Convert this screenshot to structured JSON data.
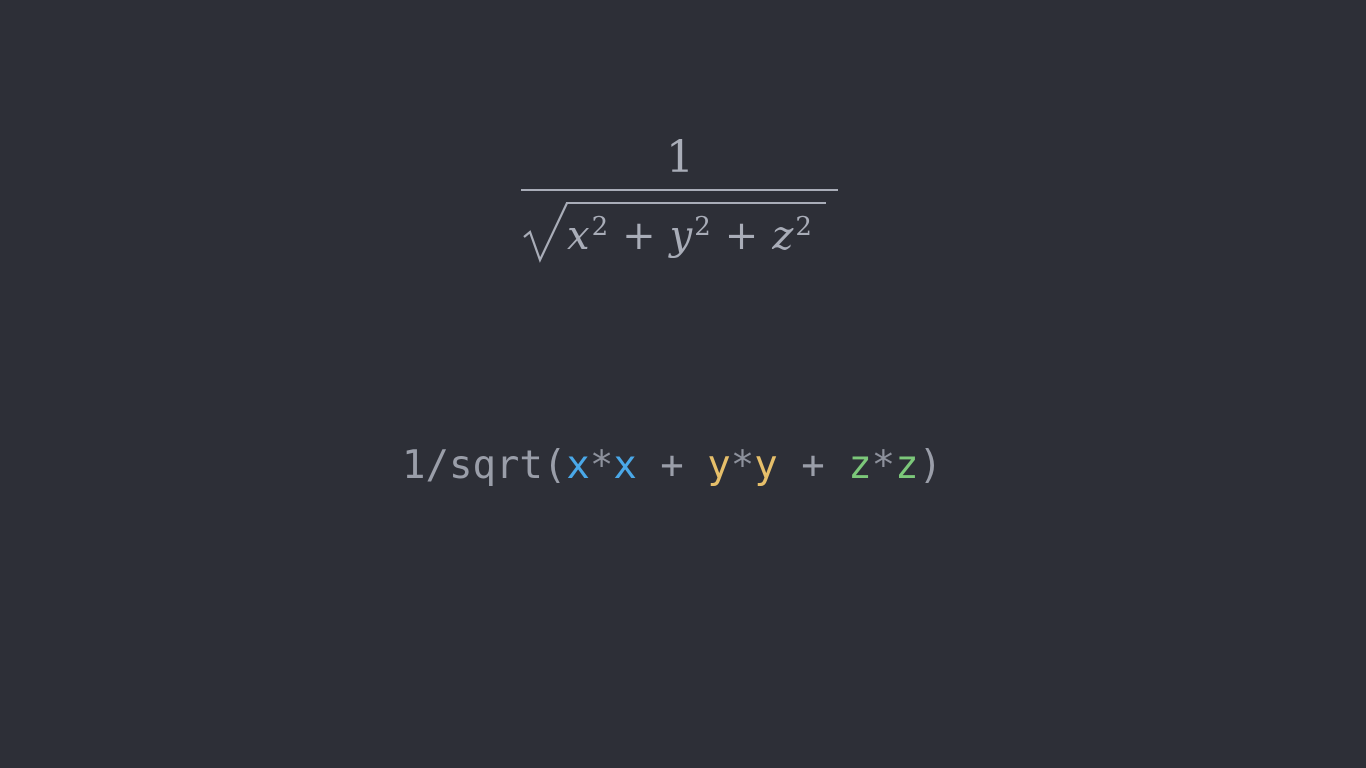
{
  "formula": {
    "numerator": "1",
    "radicand": [
      {
        "var": "x",
        "exp": "2"
      },
      {
        "op": "+"
      },
      {
        "var": "y",
        "exp": "2"
      },
      {
        "op": "+"
      },
      {
        "var": "z",
        "exp": "2"
      }
    ]
  },
  "code": {
    "prefix": "1/sqrt(",
    "x_left": "x",
    "x_star": "*",
    "x_right": "x",
    "plus_1": " + ",
    "y_left": "y",
    "y_star": "*",
    "y_right": "y",
    "plus_2": " + ",
    "z_left": "z",
    "z_star": "*",
    "z_right": "z",
    "suffix": ")"
  },
  "colors": {
    "background": "#2d2f37",
    "formula_text": "#a9adb8",
    "code_text": "#9a9ea9",
    "x_highlight": "#4aa8e8",
    "y_highlight": "#e6bf6a",
    "z_highlight": "#7cc87a"
  }
}
